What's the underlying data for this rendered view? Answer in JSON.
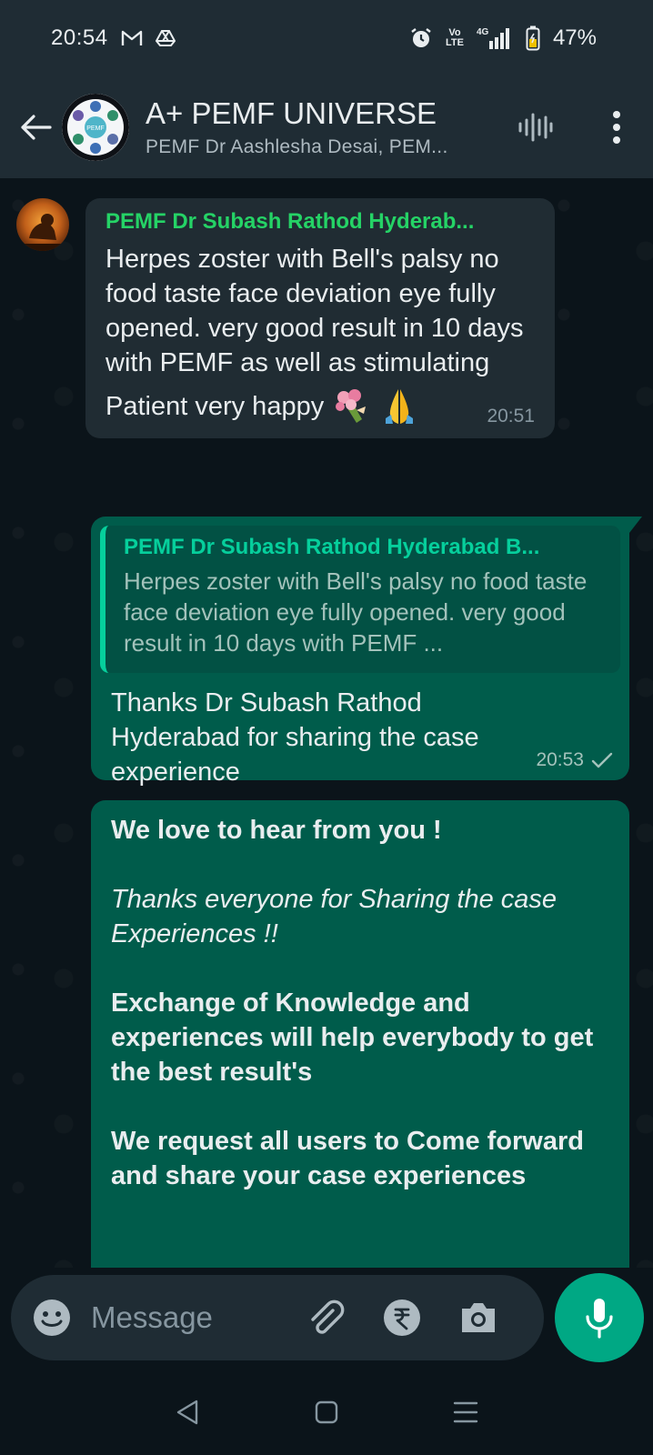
{
  "status_bar": {
    "time": "20:54",
    "network": "4G",
    "volte": "Vo\nLTE",
    "battery": "47%"
  },
  "header": {
    "title": "A+ PEMF UNIVERSE",
    "subtitle": "PEMF Dr Aashlesha Desai, PEM...",
    "avatar_label": "PEMF"
  },
  "messages": {
    "incoming": {
      "sender": "PEMF Dr Subash Rathod Hyderab...",
      "text": "Herpes zoster with Bell's palsy no food taste face deviation eye fully opened. very good result in 10 days with PEMF as well as stimulating",
      "text2": "Patient very happy",
      "time": "20:51"
    },
    "reply": {
      "quoted_sender": "PEMF Dr Subash Rathod Hyderabad B...",
      "quoted_text": "Herpes zoster with Bell's palsy no food taste face deviation eye fully opened. very good result in 10 days with PEMF ...",
      "text": "Thanks Dr Subash Rathod Hyderabad for sharing the case experience",
      "time": "20:53"
    },
    "announcement": {
      "line1": "We love to hear from you !",
      "line2": "Thanks everyone for Sharing the case Experiences  !!",
      "line3": "Exchange of Knowledge and experiences will help everybody to get the best result's",
      "line4": "We request all users to Come forward and share your case experiences"
    }
  },
  "input": {
    "placeholder": "Message"
  },
  "colors": {
    "accent_green": "#00a884",
    "sender_green": "#25d366",
    "outgoing_bubble": "#005c4b",
    "incoming_bubble": "#202c33"
  }
}
